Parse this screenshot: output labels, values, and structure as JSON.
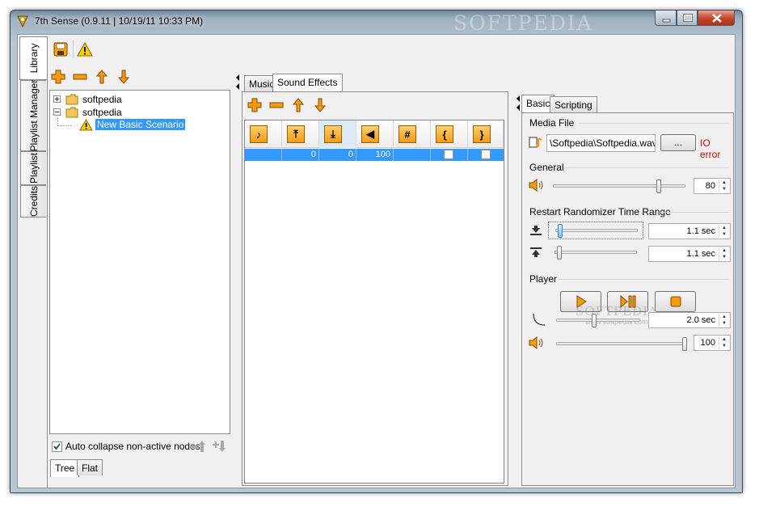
{
  "window": {
    "title": "7th Sense (0.9.11 | 10/19/11 10:33 PM)",
    "watermark": "SOFTPEDIA"
  },
  "side_tabs": [
    "Library",
    "Playlist Manager",
    "Playlist",
    "Credits"
  ],
  "library": {
    "tree": [
      {
        "label": "softpedia"
      },
      {
        "label": "softpedia"
      },
      {
        "label": "New Basic Scenario"
      }
    ],
    "auto_collapse_label": "Auto collapse non-active nodes",
    "auto_collapse_checked": true,
    "bottom_tabs": [
      "Tree",
      "Flat"
    ]
  },
  "middle": {
    "tabs": [
      "Music",
      "Sound Effects"
    ],
    "active_tab": "Sound Effects",
    "columns": [
      "music-note-icon",
      "fade-in-icon",
      "fade-out-icon",
      "volume-icon",
      "number-icon",
      "bracket-left-icon",
      "bracket-right-icon"
    ],
    "row": {
      "fade_in": "0",
      "fade_out": "0",
      "volume": "100"
    }
  },
  "right": {
    "tabs": [
      "Basic",
      "Scripting"
    ],
    "active_tab": "Basic",
    "media_file": {
      "section": "Media File",
      "value": "\\Softpedia\\Softpedia.wav",
      "browse_label": "...",
      "error_text": "IO error",
      "error_color": "#e00000"
    },
    "general": {
      "section": "General",
      "volume": "80",
      "volume_level": 0.8
    },
    "restart": {
      "section": "Restart Randomizer Time Range",
      "min": "1.1 sec",
      "max": "1.1 sec"
    },
    "player": {
      "section": "Player",
      "fade_time": "2.0 sec",
      "volume": "100",
      "watermark": "SOFTPEDIA",
      "watermark_url": "www.softpedia.com"
    }
  },
  "colors": {
    "accent_orange": "#f39a10",
    "selection_blue": "#3399ff"
  }
}
